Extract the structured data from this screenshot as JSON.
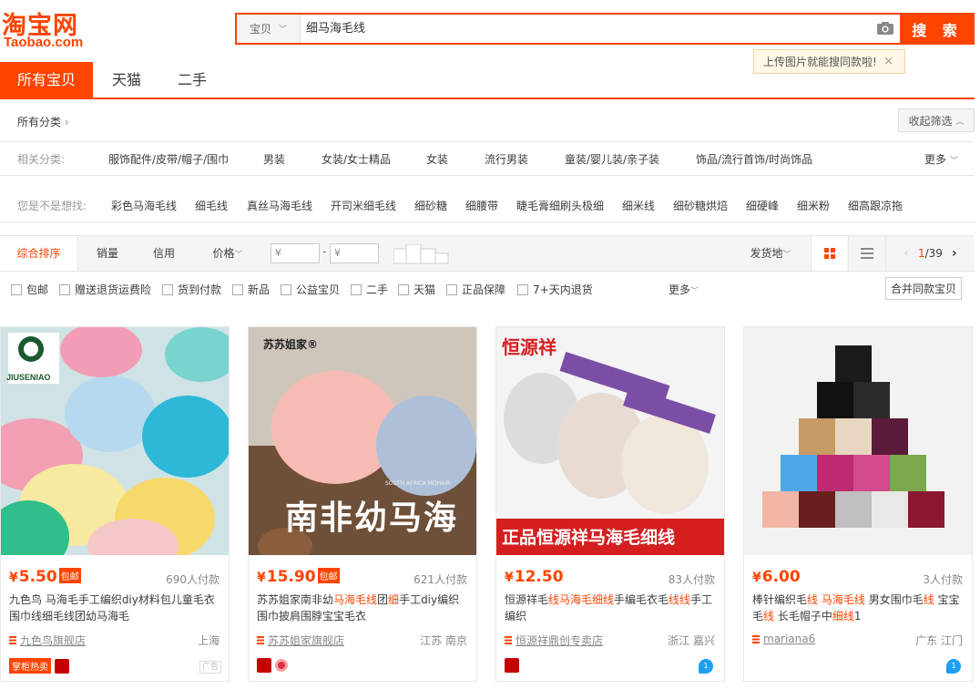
{
  "header": {
    "logo_cn": "淘宝网",
    "logo_en": "Taobao.com",
    "search_type": "宝贝",
    "search_query": "细马海毛线",
    "search_button": "搜 索",
    "tooltip": "上传图片就能搜同款啦!",
    "tooltip_close": "×"
  },
  "tabs": [
    "所有宝贝",
    "天猫",
    "二手"
  ],
  "filters": {
    "all_categories": "所有分类",
    "collapse": "收起筛选",
    "related_label": "相关分类:",
    "related": [
      "服饰配件/皮带/帽子/围巾",
      "男装",
      "女装/女士精品",
      "女装",
      "流行男装",
      "童装/婴儿装/亲子装",
      "饰品/流行首饰/时尚饰品"
    ],
    "more": "更多",
    "suggest_label": "您是不是想找:",
    "suggest": [
      "彩色马海毛线",
      "细毛线",
      "真丝马海毛线",
      "开司米细毛线",
      "细砂糖",
      "细腰带",
      "睫毛膏细刷头极细",
      "细米线",
      "细砂糖烘焙",
      "细硬峰",
      "细米粉",
      "细高跟凉拖"
    ]
  },
  "sortbar": {
    "items": [
      "综合排序",
      "销量",
      "信用",
      "价格"
    ],
    "price_from": "¥",
    "price_dash": "-",
    "price_to": "¥",
    "ship_from": "发货地",
    "page_current": "1",
    "page_total": "/39"
  },
  "checkboxes": [
    "包邮",
    "赠送退货运费险",
    "货到付款",
    "新品",
    "公益宝贝",
    "二手",
    "天猫",
    "正品保障",
    "7+天内退货"
  ],
  "checkbox_more": "更多",
  "merge_button": "合并同款宝贝",
  "products": [
    {
      "price": "5.50",
      "baoyou": "包邮",
      "paid": "690人付款",
      "title_parts": [
        {
          "t": "九色鸟 马海毛手工编织diy材料包儿童毛衣围巾线细毛线团幼马海毛",
          "h": false
        }
      ],
      "shop": "九色鸟旗舰店",
      "location": "上海",
      "badge_text": "掌柜热卖",
      "ad": "广告",
      "brand": "JIUSENIAO"
    },
    {
      "price": "15.90",
      "baoyou": "包邮",
      "paid": "621人付款",
      "title_parts": [
        {
          "t": "苏苏姐家南非幼",
          "h": false
        },
        {
          "t": "马海毛线",
          "h": true
        },
        {
          "t": "团",
          "h": false
        },
        {
          "t": "细",
          "h": true
        },
        {
          "t": "手工diy编织围巾披肩围脖宝宝毛衣",
          "h": false
        }
      ],
      "shop": "苏苏姐家旗舰店",
      "location": "江苏 南京",
      "brand": "苏苏姐家®",
      "img_text": "南非幼马海",
      "img_sub": "SOUTH AFRICA MOHAIR"
    },
    {
      "price": "12.50",
      "baoyou": "",
      "paid": "83人付款",
      "title_parts": [
        {
          "t": "恒源祥毛",
          "h": false
        },
        {
          "t": "线马海毛细线",
          "h": true
        },
        {
          "t": "手编毛衣毛",
          "h": false
        },
        {
          "t": "线线",
          "h": true
        },
        {
          "t": "手工编织",
          "h": false
        }
      ],
      "shop": "恒源祥鼎创专卖店",
      "location": "浙江 嘉兴",
      "brand": "恒源祥",
      "img_text": "正品恒源祥马海毛细线"
    },
    {
      "price": "6.00",
      "baoyou": "",
      "paid": "3人付款",
      "title_parts": [
        {
          "t": "棒针编织毛",
          "h": false
        },
        {
          "t": "线",
          "h": true
        },
        {
          "t": " ",
          "h": false
        },
        {
          "t": "马海毛线",
          "h": true
        },
        {
          "t": " 男女围巾毛",
          "h": false
        },
        {
          "t": "线",
          "h": true
        },
        {
          "t": " 宝宝毛",
          "h": false
        },
        {
          "t": "线",
          "h": true
        },
        {
          "t": " 长毛帽子中",
          "h": false
        },
        {
          "t": "细线",
          "h": true
        },
        {
          "t": "1",
          "h": false
        }
      ],
      "shop": "mariana6",
      "location": "广东 江门"
    }
  ],
  "colors": {
    "accent": "#ff4400",
    "wangwang": "#1e9ff2"
  }
}
